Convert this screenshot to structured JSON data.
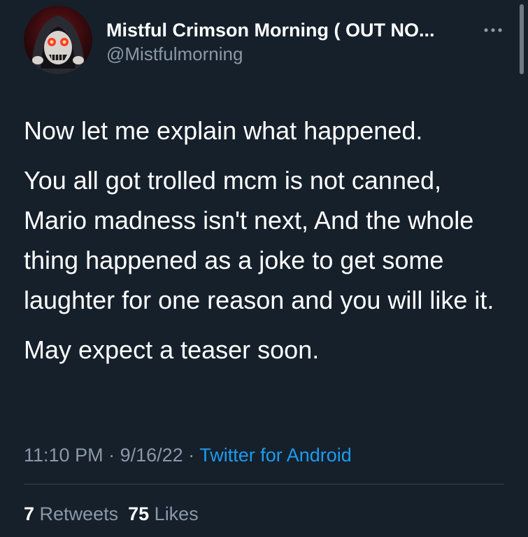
{
  "author": {
    "display_name": "Mistful Crimson Morning ( OUT NO...",
    "handle": "@Mistfulmorning",
    "avatar_icon": "hooded-figure-avatar",
    "more_icon": "more-options-icon"
  },
  "tweet": {
    "paragraphs": [
      "Now let me explain what happened.",
      "You all got trolled mcm is not canned, Mario madness isn't next, And the whole thing happened as a joke to get some laughter for one reason and you will like it.",
      "May expect a teaser soon."
    ]
  },
  "meta": {
    "time": "11:10 PM",
    "sep1": " · ",
    "date": "9/16/22",
    "sep2": " · ",
    "source": "Twitter for Android"
  },
  "stats": {
    "retweets_count": "7",
    "retweets_label": "Retweets",
    "likes_count": "75",
    "likes_label": "Likes"
  },
  "colors": {
    "background": "#15202b",
    "text_primary": "#ffffff",
    "text_secondary": "#8b98a5",
    "link": "#1d9bf0",
    "divider": "#38444d"
  }
}
